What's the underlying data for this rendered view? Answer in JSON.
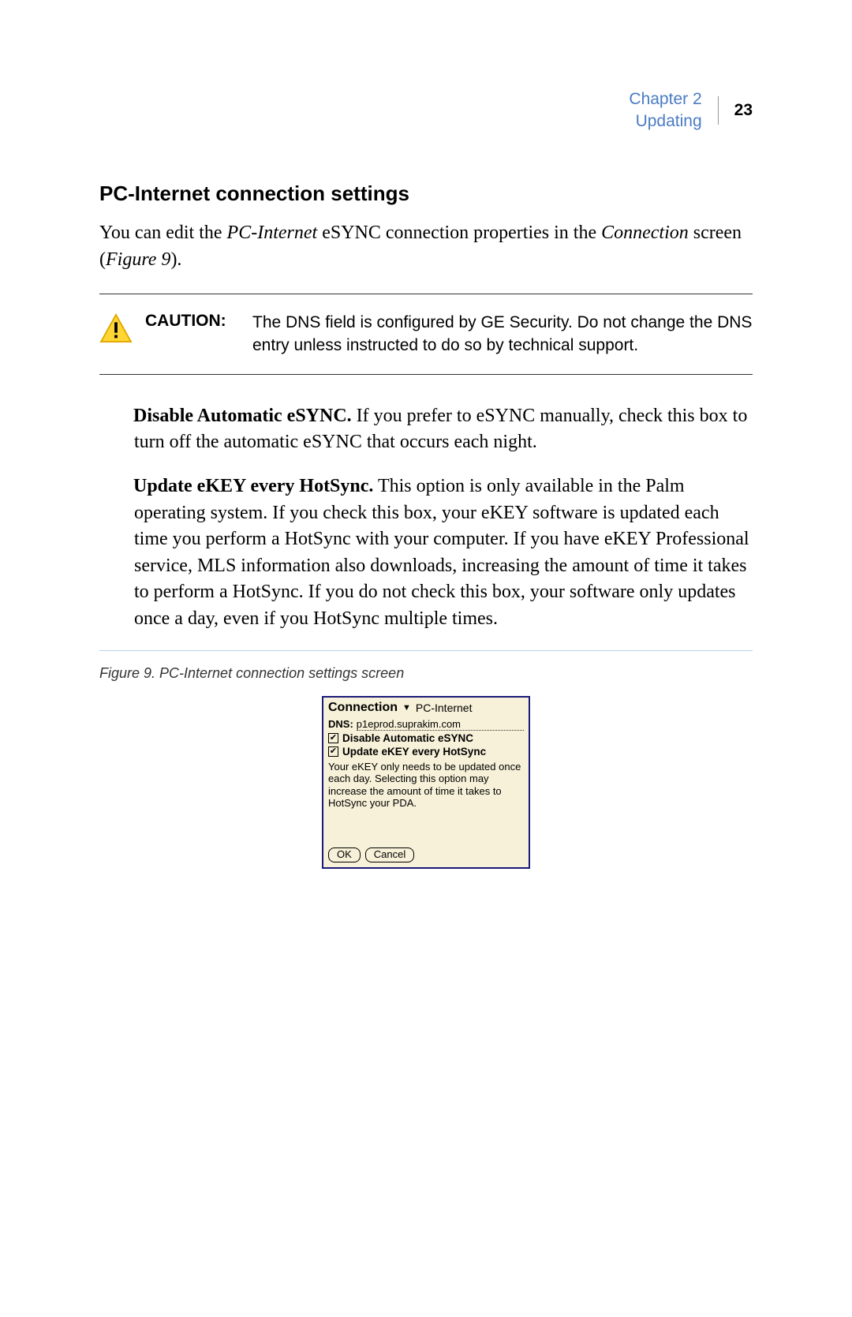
{
  "header": {
    "chapter": "Chapter 2",
    "section": "Updating",
    "page": "23"
  },
  "heading": "PC-Internet connection settings",
  "intro": {
    "prefix": "You can edit the ",
    "italic1": "PC-Internet",
    "mid": " eSYNC connection properties in the ",
    "italic2": "Connection",
    "suffix1": " screen (",
    "italic3": "Figure 9",
    "suffix2": ")."
  },
  "caution": {
    "label": "CAUTION:",
    "text": "The DNS field is configured by GE Security.  Do not change the DNS entry unless instructed to do so by technical support."
  },
  "options": [
    {
      "lead": "Disable Automatic eSYNC.",
      "body": "  If you prefer to eSYNC manually, check this box to turn off the automatic eSYNC that occurs each night."
    },
    {
      "lead": "Update eKEY every HotSync.",
      "body": "  This option is only available in the Palm operating system.  If you check this box, your eKEY software is updated each time you perform a HotSync with your computer.  If you have eKEY Professional service, MLS information also downloads, increasing the amount of time it takes to perform a HotSync.  If you do not check this box, your software only updates once a day, even if you HotSync multiple times."
    }
  ],
  "figure": {
    "caption": "Figure 9.    PC-Internet connection settings screen"
  },
  "palm": {
    "title": "Connection",
    "dropdown": "PC-Internet",
    "dnsLabel": "DNS:",
    "dnsValue": "p1eprod.suprakim.com",
    "check1": "Disable Automatic eSYNC",
    "check2": "Update eKEY every HotSync",
    "help": "Your eKEY only needs to be updated once each day.  Selecting this option may increase the amount of time it takes to HotSync your PDA.",
    "ok": "OK",
    "cancel": "Cancel"
  }
}
